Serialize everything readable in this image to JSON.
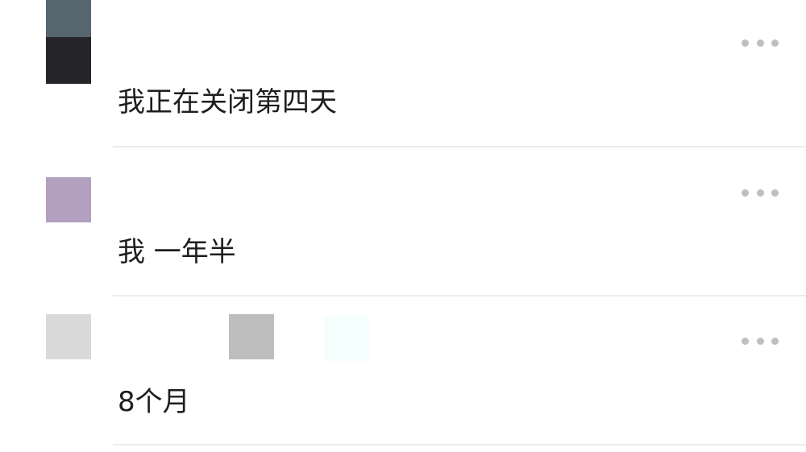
{
  "comments": [
    {
      "text": "我正在关闭第四天",
      "more_icon": "more-horizontal-icon"
    },
    {
      "text": "我 一年半",
      "more_icon": "more-horizontal-icon"
    },
    {
      "text": "8个月",
      "more_icon": "more-horizontal-icon"
    }
  ],
  "colors": {
    "text": "#1e1e1e",
    "divider": "#ececec",
    "more_dots": "#bfbfbf",
    "avatar_1_top": "#56656e",
    "avatar_1_bottom": "#252428",
    "avatar_2": "#b39fc0",
    "avatar_3": "#d9d9d9"
  }
}
